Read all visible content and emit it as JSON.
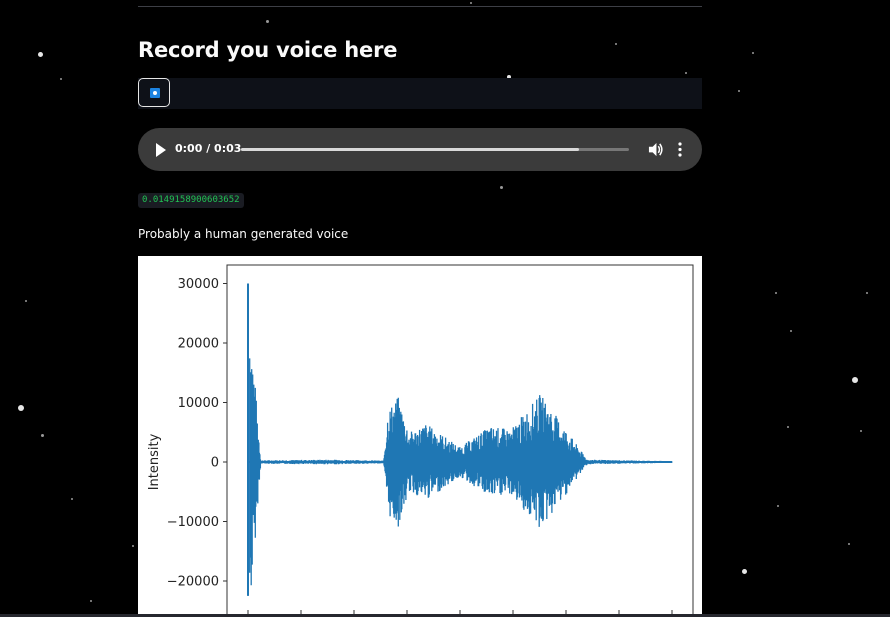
{
  "page": {
    "title": "Record you voice here"
  },
  "recorder": {
    "record_button_icon": "stop-record-icon",
    "accent_color": "#1c83e1"
  },
  "audio_player": {
    "time": "0:00 / 0:03",
    "progress": 0.87,
    "icons": [
      "play-icon",
      "volume-icon",
      "more-vertical-icon"
    ]
  },
  "result": {
    "score": "0.0149158900603652",
    "label": "Probably a human generated voice",
    "score_color": "#21c354"
  },
  "chart_data": {
    "type": "line",
    "ylabel": "Intensity",
    "yticks": [
      30000,
      20000,
      10000,
      0,
      -10000,
      -20000
    ],
    "ylim": [
      -25000,
      33000
    ],
    "xlim": [
      -0.05,
      1.0
    ],
    "series_color": "#1f77b4",
    "description_segments": [
      {
        "x": 0.0,
        "amp": 30000,
        "amp_low": -22500
      },
      {
        "x": 0.03,
        "amp": 300
      },
      {
        "x": 0.2,
        "amp": 400
      },
      {
        "x": 0.32,
        "amp": 250
      },
      {
        "x": 0.33,
        "amp": 9000
      },
      {
        "x": 0.355,
        "amp": 11000
      },
      {
        "x": 0.38,
        "amp": 5000
      },
      {
        "x": 0.42,
        "amp": 6500
      },
      {
        "x": 0.5,
        "amp": 2500
      },
      {
        "x": 0.57,
        "amp": 6000
      },
      {
        "x": 0.62,
        "amp": 5500
      },
      {
        "x": 0.69,
        "amp": 11500
      },
      {
        "x": 0.8,
        "amp": 400
      },
      {
        "x": 1.0,
        "amp": 150
      }
    ]
  }
}
